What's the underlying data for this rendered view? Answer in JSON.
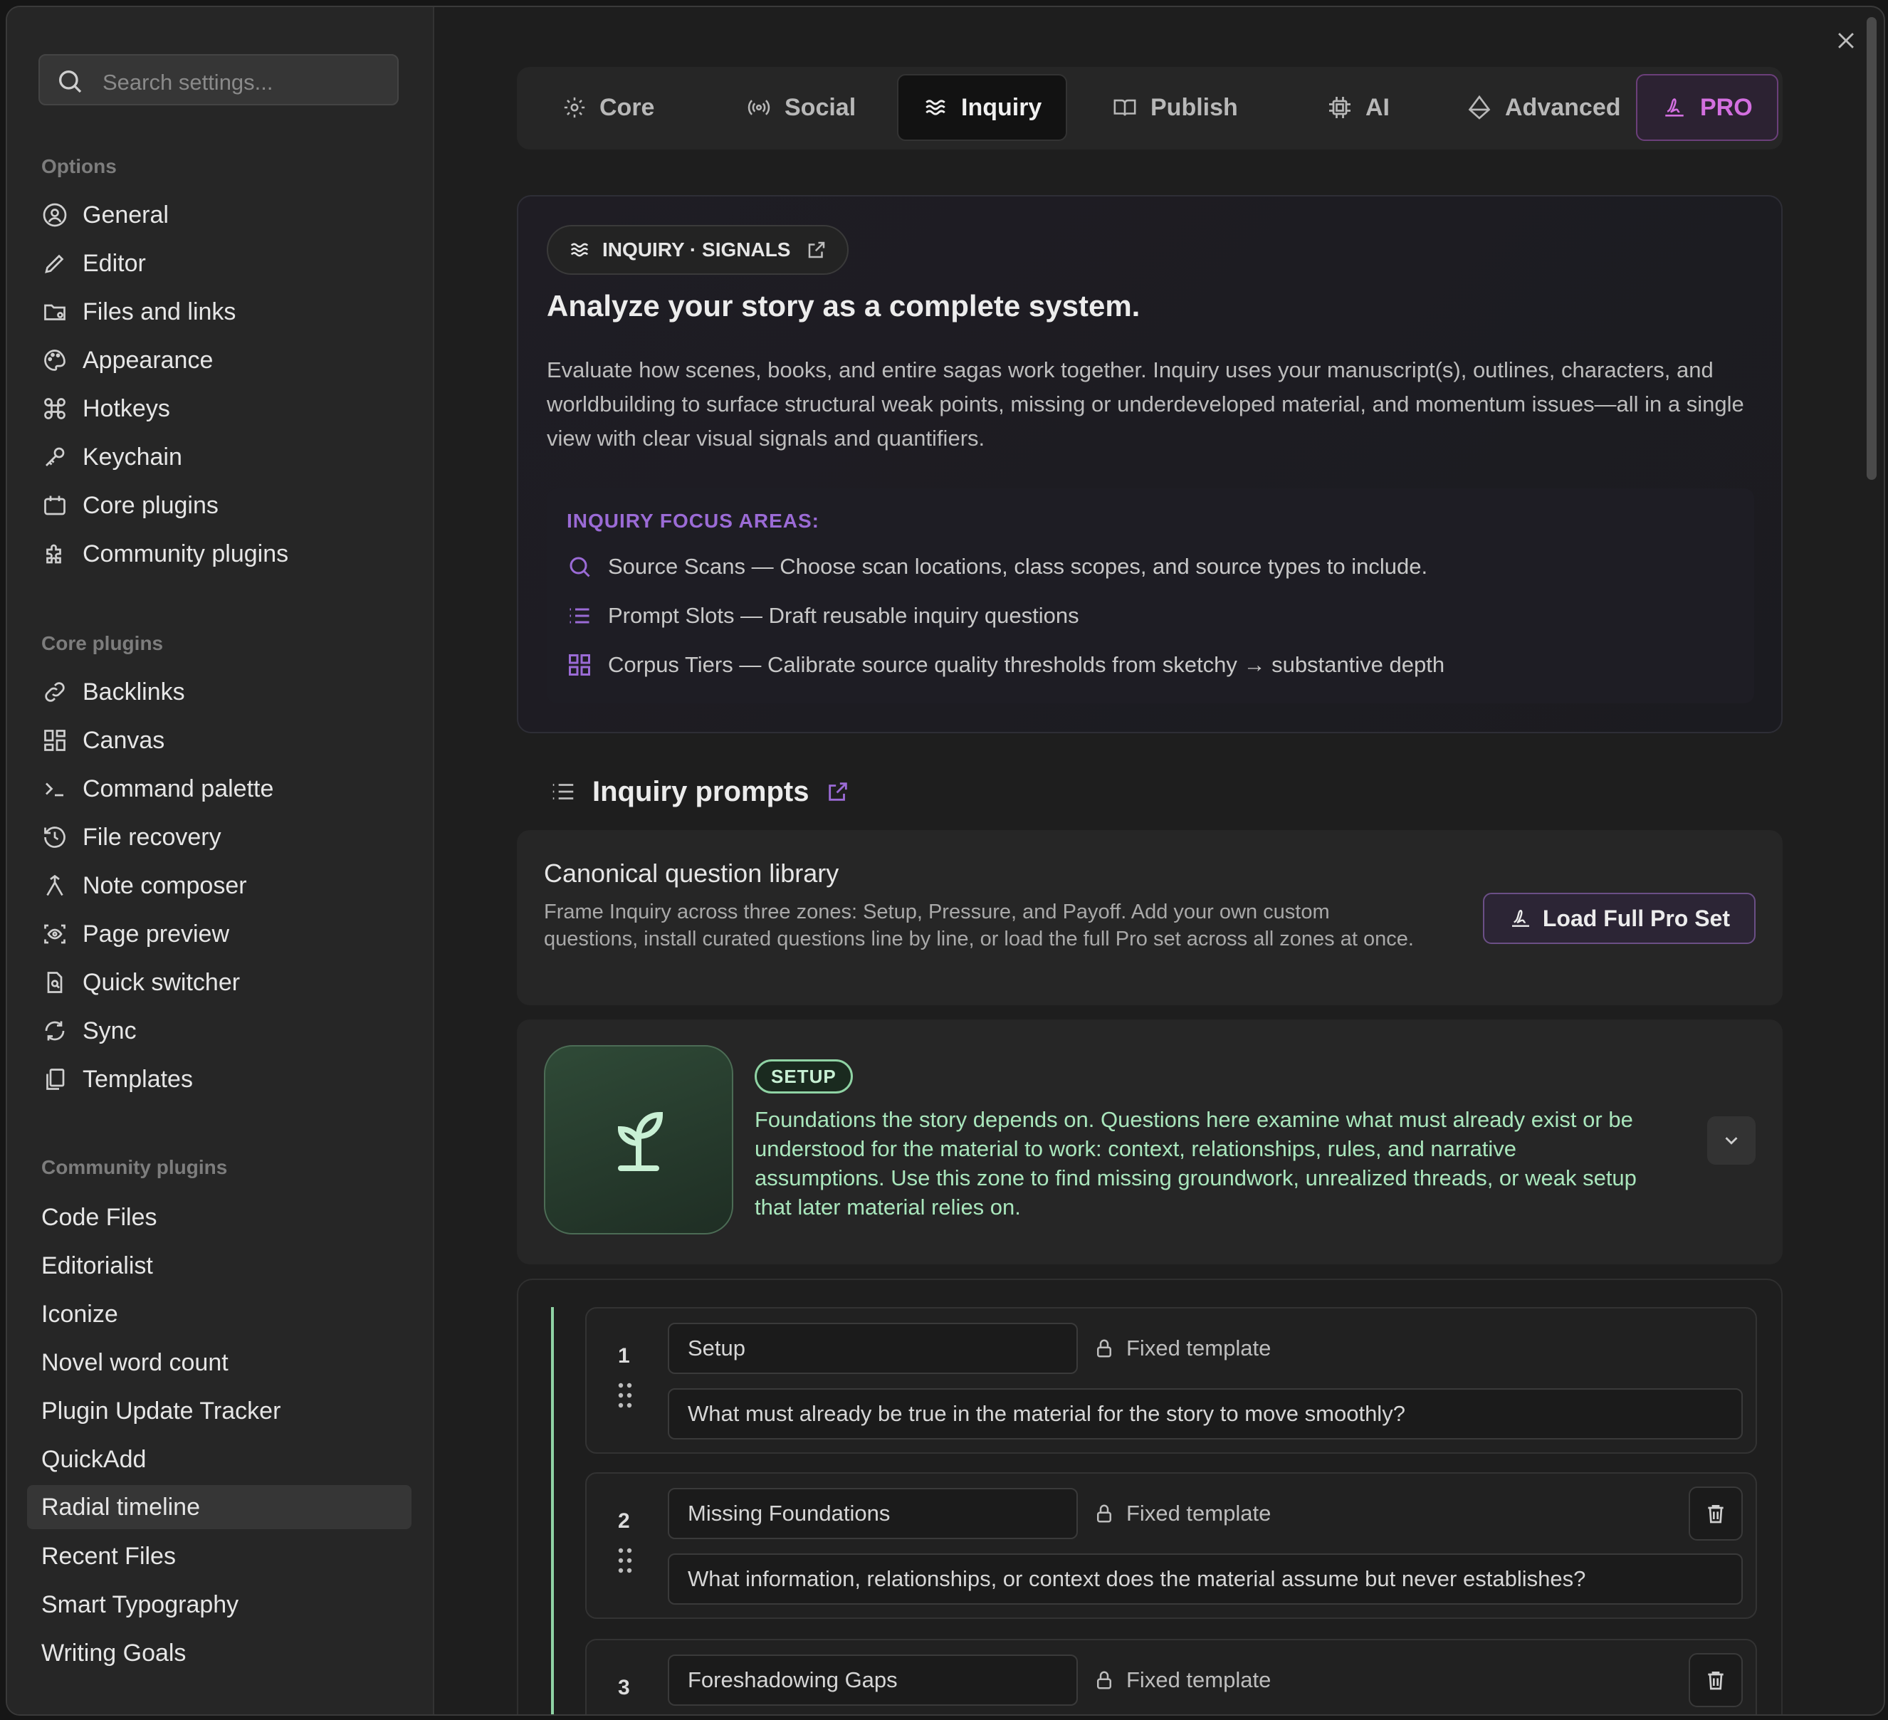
{
  "search": {
    "placeholder": "Search settings..."
  },
  "sidebar": {
    "options_title": "Options",
    "options": [
      {
        "label": "General",
        "icon": "user-circle-icon"
      },
      {
        "label": "Editor",
        "icon": "pencil-icon"
      },
      {
        "label": "Files and links",
        "icon": "folder-cog-icon"
      },
      {
        "label": "Appearance",
        "icon": "palette-icon"
      },
      {
        "label": "Hotkeys",
        "icon": "command-icon"
      },
      {
        "label": "Keychain",
        "icon": "key-icon"
      },
      {
        "label": "Core plugins",
        "icon": "calendar-icon"
      },
      {
        "label": "Community plugins",
        "icon": "puzzle-icon"
      }
    ],
    "core_title": "Core plugins",
    "core": [
      {
        "label": "Backlinks",
        "icon": "link-icon"
      },
      {
        "label": "Canvas",
        "icon": "layout-dashboard-icon"
      },
      {
        "label": "Command palette",
        "icon": "terminal-icon"
      },
      {
        "label": "File recovery",
        "icon": "history-icon"
      },
      {
        "label": "Note composer",
        "icon": "merge-icon"
      },
      {
        "label": "Page preview",
        "icon": "scan-eye-icon"
      },
      {
        "label": "Quick switcher",
        "icon": "file-search-icon"
      },
      {
        "label": "Sync",
        "icon": "refresh-icon"
      },
      {
        "label": "Templates",
        "icon": "files-icon"
      }
    ],
    "community_title": "Community plugins",
    "community": [
      "Code Files",
      "Editorialist",
      "Iconize",
      "Novel word count",
      "Plugin Update Tracker",
      "QuickAdd",
      "Radial timeline",
      "Recent Files",
      "Smart Typography",
      "Writing Goals"
    ],
    "active_item": "Radial timeline"
  },
  "tabs": [
    {
      "label": "Core",
      "icon": "gear-icon"
    },
    {
      "label": "Social",
      "icon": "broadcast-icon"
    },
    {
      "label": "Inquiry",
      "icon": "waves-icon"
    },
    {
      "label": "Publish",
      "icon": "book-icon"
    },
    {
      "label": "AI",
      "icon": "cpu-icon"
    },
    {
      "label": "Advanced",
      "icon": "diamond-icon"
    },
    {
      "label": "PRO",
      "icon": "signature-icon"
    }
  ],
  "hero": {
    "pill_label": "INQUIRY · SIGNALS",
    "title": "Analyze your story as a complete system.",
    "description": "Evaluate how scenes, books, and entire sagas work together. Inquiry uses your manuscript(s), outlines, characters, and worldbuilding to surface structural weak points, missing or underdeveloped material, and momentum issues—all in a single view with clear visual signals and quantifiers.",
    "focus_title": "INQUIRY FOCUS AREAS:",
    "focus_items": [
      {
        "text": "Source Scans — Choose scan locations, class scopes, and source types to include.",
        "icon": "search-icon"
      },
      {
        "text": "Prompt Slots — Draft reusable inquiry questions",
        "icon": "list-icon"
      },
      {
        "text": "Corpus Tiers — Calibrate source quality thresholds from sketchy → substantive depth",
        "icon": "grid-icon"
      }
    ]
  },
  "prompts": {
    "heading": "Inquiry prompts"
  },
  "library": {
    "title": "Canonical question library",
    "description": "Frame Inquiry across three zones: Setup, Pressure, and Payoff. Add your own custom questions, install curated questions line by line, or load the full Pro set across all zones at once.",
    "button_label": "Load Full Pro Set"
  },
  "setup": {
    "badge": "SETUP",
    "icon": "sprout-icon",
    "description": "Foundations the story depends on. Questions here examine what must already exist or be understood for the material to work: context, relationships, rules, and narrative assumptions. Use this zone to find missing groundwork, unrealized threads, or weak setup that later material relies on."
  },
  "questions": [
    {
      "num": "1",
      "name": "Setup",
      "lock_label": "Fixed template",
      "text": "What must already be true in the material for the story to move smoothly?"
    },
    {
      "num": "2",
      "name": "Missing Foundations",
      "lock_label": "Fixed template",
      "text": "What information, relationships, or context does the material assume but never establishes?"
    },
    {
      "num": "3",
      "name": "Foreshadowing Gaps",
      "lock_label": "Fixed template",
      "text": ""
    }
  ],
  "colors": {
    "accent_purple": "#9b6bd6",
    "pro_pink": "#d36fe0",
    "setup_green": "#8fd3a4"
  }
}
